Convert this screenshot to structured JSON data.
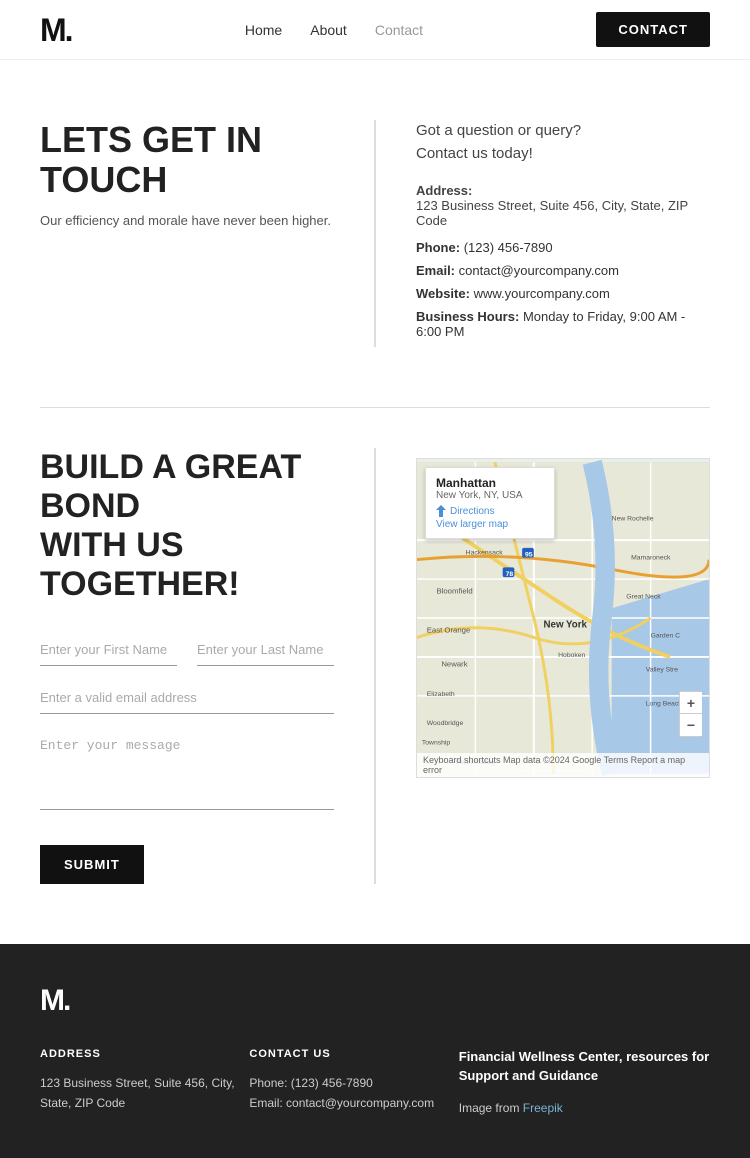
{
  "navbar": {
    "logo": "M.",
    "links": [
      {
        "label": "Home",
        "active": false
      },
      {
        "label": "About",
        "active": false
      },
      {
        "label": "Contact",
        "active": true
      }
    ],
    "contact_button": "CONTACT"
  },
  "section1": {
    "heading": "LETS GET IN TOUCH",
    "subtext": "Our efficiency and morale have never been higher.",
    "tagline_line1": "Got a question or query?",
    "tagline_line2": "Contact us today!",
    "address_label": "Address:",
    "address_value": "123 Business Street, Suite 456, City, State, ZIP Code",
    "phone_label": "Phone:",
    "phone_value": "(123) 456-7890",
    "email_label": "Email:",
    "email_value": "contact@yourcompany.com",
    "website_label": "Website:",
    "website_value": "www.yourcompany.com",
    "hours_label": "Business Hours:",
    "hours_value": "Monday to Friday, 9:00 AM - 6:00 PM"
  },
  "section2": {
    "heading_line1": "BUILD A GREAT BOND",
    "heading_line2": "WITH US TOGETHER!",
    "first_name_placeholder": "Enter your First Name",
    "last_name_placeholder": "Enter your Last Name",
    "email_placeholder": "Enter a valid email address",
    "message_placeholder": "Enter your message",
    "submit_label": "SUBMIT"
  },
  "map": {
    "place_name": "Manhattan",
    "place_sub": "New York, NY, USA",
    "directions_label": "Directions",
    "view_larger": "View larger map",
    "zoom_in": "+",
    "zoom_out": "−",
    "bottom_text": "Keyboard shortcuts  Map data ©2024 Google  Terms  Report a map error"
  },
  "footer": {
    "logo": "M.",
    "address_heading": "ADDRESS",
    "address_line1": "123 Business Street, Suite 456, City,",
    "address_line2": "State, ZIP Code",
    "contact_heading": "CONTACT US",
    "phone": "Phone: (123) 456-7890",
    "email": "Email: contact@yourcompany.com",
    "resource_heading": "Financial Wellness Center, resources for Support and Guidance",
    "resource_text": "Image from ",
    "resource_link": "Freepik"
  }
}
